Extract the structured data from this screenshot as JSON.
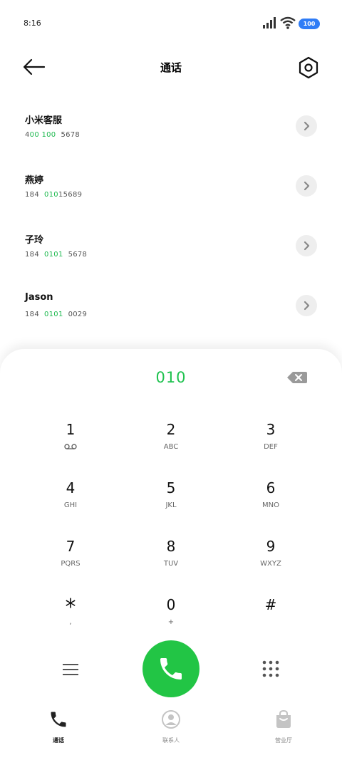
{
  "status_bar": {
    "time": "8:16",
    "battery": "100"
  },
  "header": {
    "title": "通话"
  },
  "contacts": [
    {
      "name": "小米客服",
      "number_parts": [
        {
          "t": "4",
          "h": false
        },
        {
          "t": "00",
          "h": true
        },
        {
          "t": " ",
          "h": false
        },
        {
          "t": "100",
          "h": true
        },
        {
          "t": "  5678",
          "h": false
        }
      ]
    },
    {
      "name": "燕婷",
      "number_parts": [
        {
          "t": "184  ",
          "h": false
        },
        {
          "t": "010",
          "h": true
        },
        {
          "t": "15689",
          "h": false
        }
      ]
    },
    {
      "name": "子玲",
      "number_parts": [
        {
          "t": "184  ",
          "h": false
        },
        {
          "t": "0101",
          "h": true
        },
        {
          "t": "  5678",
          "h": false
        }
      ]
    },
    {
      "name": "Jason",
      "number_parts": [
        {
          "t": "184  ",
          "h": false
        },
        {
          "t": "0101",
          "h": true
        },
        {
          "t": "  0029",
          "h": false
        }
      ]
    }
  ],
  "dialpad": {
    "entered_number": "010",
    "keys": [
      {
        "digit": "1",
        "sub": ""
      },
      {
        "digit": "2",
        "sub": "ABC"
      },
      {
        "digit": "3",
        "sub": "DEF"
      },
      {
        "digit": "4",
        "sub": "GHI"
      },
      {
        "digit": "5",
        "sub": "JKL"
      },
      {
        "digit": "6",
        "sub": "MNO"
      },
      {
        "digit": "7",
        "sub": "PQRS"
      },
      {
        "digit": "8",
        "sub": "TUV"
      },
      {
        "digit": "9",
        "sub": "WXYZ"
      },
      {
        "digit": "*",
        "sub": ","
      },
      {
        "digit": "0",
        "sub": "+"
      },
      {
        "digit": "#",
        "sub": ""
      }
    ]
  },
  "tabs": [
    {
      "label": "通话",
      "icon": "phone-icon",
      "active": true
    },
    {
      "label": "联系人",
      "icon": "person-icon",
      "active": false
    },
    {
      "label": "营业厅",
      "icon": "bag-icon",
      "active": false
    }
  ],
  "colors": {
    "accent": "#22c545",
    "highlight": "#1db94f",
    "battery": "#2f7cf6"
  }
}
